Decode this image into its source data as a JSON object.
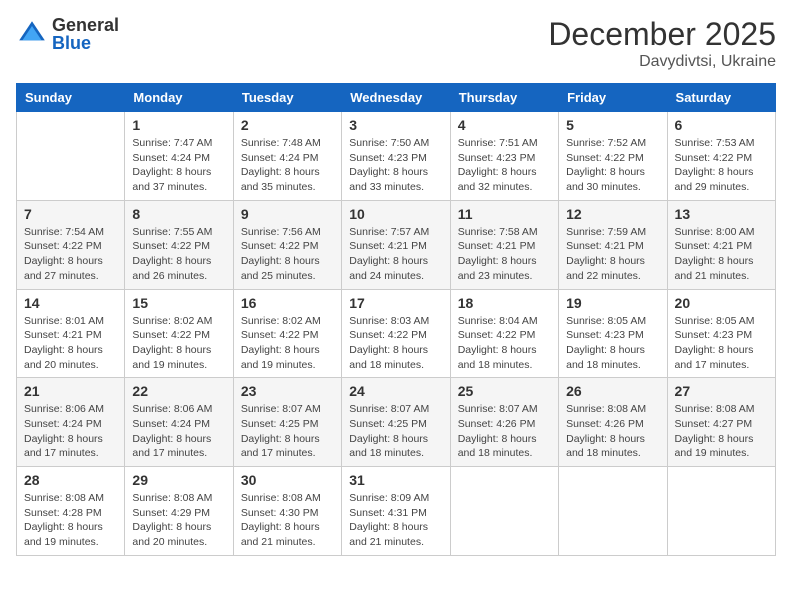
{
  "logo": {
    "general": "General",
    "blue": "Blue"
  },
  "header": {
    "month": "December 2025",
    "location": "Davydivtsi, Ukraine"
  },
  "weekdays": [
    "Sunday",
    "Monday",
    "Tuesday",
    "Wednesday",
    "Thursday",
    "Friday",
    "Saturday"
  ],
  "weeks": [
    [
      {
        "day": "",
        "info": ""
      },
      {
        "day": "1",
        "info": "Sunrise: 7:47 AM\nSunset: 4:24 PM\nDaylight: 8 hours\nand 37 minutes."
      },
      {
        "day": "2",
        "info": "Sunrise: 7:48 AM\nSunset: 4:24 PM\nDaylight: 8 hours\nand 35 minutes."
      },
      {
        "day": "3",
        "info": "Sunrise: 7:50 AM\nSunset: 4:23 PM\nDaylight: 8 hours\nand 33 minutes."
      },
      {
        "day": "4",
        "info": "Sunrise: 7:51 AM\nSunset: 4:23 PM\nDaylight: 8 hours\nand 32 minutes."
      },
      {
        "day": "5",
        "info": "Sunrise: 7:52 AM\nSunset: 4:22 PM\nDaylight: 8 hours\nand 30 minutes."
      },
      {
        "day": "6",
        "info": "Sunrise: 7:53 AM\nSunset: 4:22 PM\nDaylight: 8 hours\nand 29 minutes."
      }
    ],
    [
      {
        "day": "7",
        "info": "Sunrise: 7:54 AM\nSunset: 4:22 PM\nDaylight: 8 hours\nand 27 minutes."
      },
      {
        "day": "8",
        "info": "Sunrise: 7:55 AM\nSunset: 4:22 PM\nDaylight: 8 hours\nand 26 minutes."
      },
      {
        "day": "9",
        "info": "Sunrise: 7:56 AM\nSunset: 4:22 PM\nDaylight: 8 hours\nand 25 minutes."
      },
      {
        "day": "10",
        "info": "Sunrise: 7:57 AM\nSunset: 4:21 PM\nDaylight: 8 hours\nand 24 minutes."
      },
      {
        "day": "11",
        "info": "Sunrise: 7:58 AM\nSunset: 4:21 PM\nDaylight: 8 hours\nand 23 minutes."
      },
      {
        "day": "12",
        "info": "Sunrise: 7:59 AM\nSunset: 4:21 PM\nDaylight: 8 hours\nand 22 minutes."
      },
      {
        "day": "13",
        "info": "Sunrise: 8:00 AM\nSunset: 4:21 PM\nDaylight: 8 hours\nand 21 minutes."
      }
    ],
    [
      {
        "day": "14",
        "info": "Sunrise: 8:01 AM\nSunset: 4:21 PM\nDaylight: 8 hours\nand 20 minutes."
      },
      {
        "day": "15",
        "info": "Sunrise: 8:02 AM\nSunset: 4:22 PM\nDaylight: 8 hours\nand 19 minutes."
      },
      {
        "day": "16",
        "info": "Sunrise: 8:02 AM\nSunset: 4:22 PM\nDaylight: 8 hours\nand 19 minutes."
      },
      {
        "day": "17",
        "info": "Sunrise: 8:03 AM\nSunset: 4:22 PM\nDaylight: 8 hours\nand 18 minutes."
      },
      {
        "day": "18",
        "info": "Sunrise: 8:04 AM\nSunset: 4:22 PM\nDaylight: 8 hours\nand 18 minutes."
      },
      {
        "day": "19",
        "info": "Sunrise: 8:05 AM\nSunset: 4:23 PM\nDaylight: 8 hours\nand 18 minutes."
      },
      {
        "day": "20",
        "info": "Sunrise: 8:05 AM\nSunset: 4:23 PM\nDaylight: 8 hours\nand 17 minutes."
      }
    ],
    [
      {
        "day": "21",
        "info": "Sunrise: 8:06 AM\nSunset: 4:24 PM\nDaylight: 8 hours\nand 17 minutes."
      },
      {
        "day": "22",
        "info": "Sunrise: 8:06 AM\nSunset: 4:24 PM\nDaylight: 8 hours\nand 17 minutes."
      },
      {
        "day": "23",
        "info": "Sunrise: 8:07 AM\nSunset: 4:25 PM\nDaylight: 8 hours\nand 17 minutes."
      },
      {
        "day": "24",
        "info": "Sunrise: 8:07 AM\nSunset: 4:25 PM\nDaylight: 8 hours\nand 18 minutes."
      },
      {
        "day": "25",
        "info": "Sunrise: 8:07 AM\nSunset: 4:26 PM\nDaylight: 8 hours\nand 18 minutes."
      },
      {
        "day": "26",
        "info": "Sunrise: 8:08 AM\nSunset: 4:26 PM\nDaylight: 8 hours\nand 18 minutes."
      },
      {
        "day": "27",
        "info": "Sunrise: 8:08 AM\nSunset: 4:27 PM\nDaylight: 8 hours\nand 19 minutes."
      }
    ],
    [
      {
        "day": "28",
        "info": "Sunrise: 8:08 AM\nSunset: 4:28 PM\nDaylight: 8 hours\nand 19 minutes."
      },
      {
        "day": "29",
        "info": "Sunrise: 8:08 AM\nSunset: 4:29 PM\nDaylight: 8 hours\nand 20 minutes."
      },
      {
        "day": "30",
        "info": "Sunrise: 8:08 AM\nSunset: 4:30 PM\nDaylight: 8 hours\nand 21 minutes."
      },
      {
        "day": "31",
        "info": "Sunrise: 8:09 AM\nSunset: 4:31 PM\nDaylight: 8 hours\nand 21 minutes."
      },
      {
        "day": "",
        "info": ""
      },
      {
        "day": "",
        "info": ""
      },
      {
        "day": "",
        "info": ""
      }
    ]
  ]
}
